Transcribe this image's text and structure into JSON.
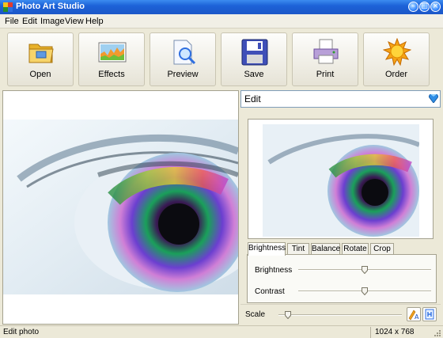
{
  "window": {
    "title": "Photo Art Studio"
  },
  "menu": [
    "File",
    "Edit",
    "Image",
    "View",
    "Help"
  ],
  "toolbar": [
    {
      "label": "Open",
      "icon": "folder-icon"
    },
    {
      "label": "Effects",
      "icon": "effects-chart-icon"
    },
    {
      "label": "Preview",
      "icon": "preview-magnifier-icon"
    },
    {
      "label": "Save",
      "icon": "floppy-disk-icon"
    },
    {
      "label": "Print",
      "icon": "printer-icon"
    },
    {
      "label": "Order",
      "icon": "sun-icon"
    }
  ],
  "edit_panel": {
    "title": "Edit",
    "tabs": [
      "Brightness",
      "Tint",
      "Balance",
      "Rotate",
      "Crop"
    ],
    "active_tab": "Brightness",
    "sliders": [
      {
        "label": "Brightness",
        "value": 0.5
      },
      {
        "label": "Contrast",
        "value": 0.5
      }
    ],
    "scale": {
      "label": "Scale",
      "value": 0.08
    }
  },
  "status": {
    "left": "Edit photo",
    "right": "1024 x 768"
  },
  "colors": {
    "title_bar": "#1d62d8",
    "accent": "#3c8cf0"
  }
}
